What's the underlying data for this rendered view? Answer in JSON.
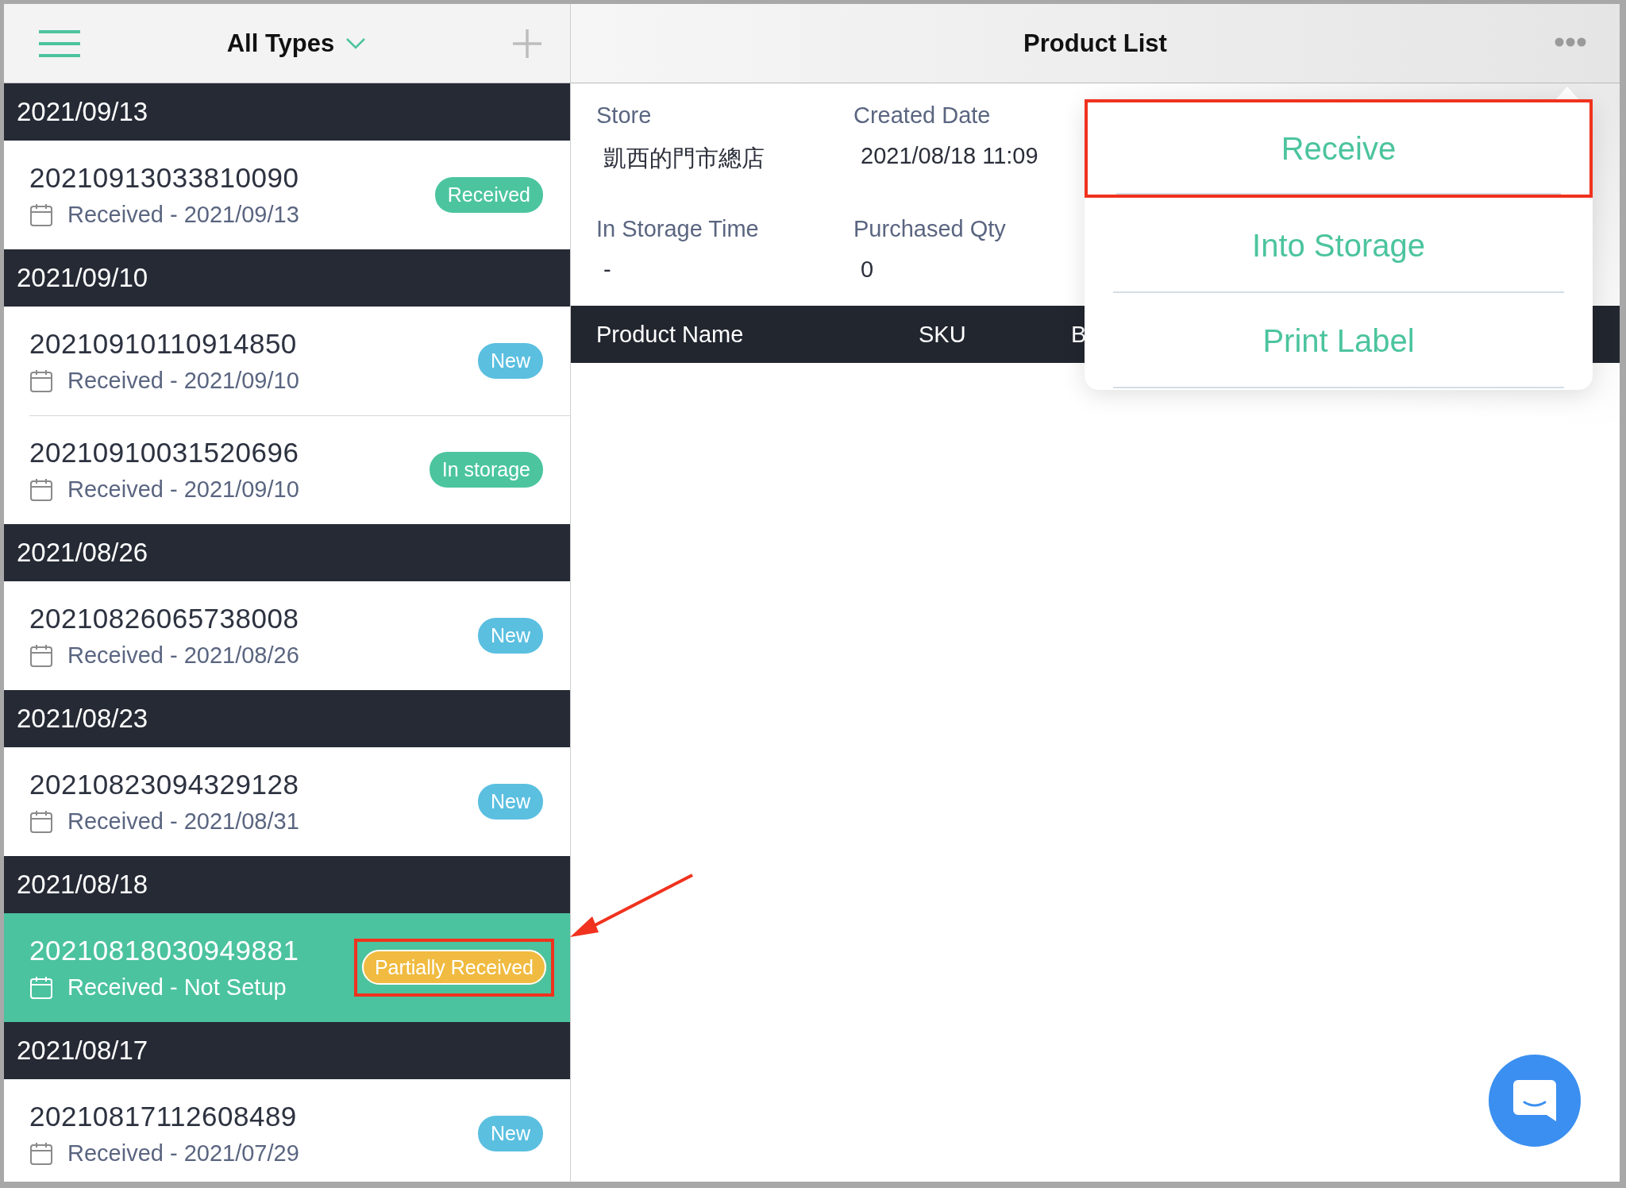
{
  "sidebar": {
    "title": "All Types",
    "groups": [
      {
        "date": "2021/09/13",
        "orders": [
          {
            "number": "20210913033810090",
            "subtitle": "Received - 2021/09/13",
            "status": "Received",
            "color": "#4cc59f",
            "selected": false,
            "highlighted": false
          }
        ]
      },
      {
        "date": "2021/09/10",
        "orders": [
          {
            "number": "20210910110914850",
            "subtitle": "Received - 2021/09/10",
            "status": "New",
            "color": "#5bbfe0",
            "selected": false,
            "highlighted": false
          },
          {
            "number": "20210910031520696",
            "subtitle": "Received - 2021/09/10",
            "status": "In storage",
            "color": "#4cc59f",
            "selected": false,
            "highlighted": false
          }
        ]
      },
      {
        "date": "2021/08/26",
        "orders": [
          {
            "number": "20210826065738008",
            "subtitle": "Received - 2021/08/26",
            "status": "New",
            "color": "#5bbfe0",
            "selected": false,
            "highlighted": false
          }
        ]
      },
      {
        "date": "2021/08/23",
        "orders": [
          {
            "number": "20210823094329128",
            "subtitle": "Received - 2021/08/31",
            "status": "New",
            "color": "#5bbfe0",
            "selected": false,
            "highlighted": false
          }
        ]
      },
      {
        "date": "2021/08/18",
        "orders": [
          {
            "number": "20210818030949881",
            "subtitle": "Received - Not Setup",
            "status": "Partially Received",
            "color": "#f0bb40",
            "selected": true,
            "highlighted": true
          }
        ]
      },
      {
        "date": "2021/08/17",
        "orders": [
          {
            "number": "20210817112608489",
            "subtitle": "Received - 2021/07/29",
            "status": "New",
            "color": "#5bbfe0",
            "selected": false,
            "highlighted": false
          }
        ]
      }
    ]
  },
  "detail": {
    "title": "Product List",
    "fields": [
      {
        "label": "Store",
        "value": "凱西的門市總店"
      },
      {
        "label": "Created Date",
        "value": "2021/08/18 11:09"
      },
      {
        "label": "In Storage Time",
        "value": "-"
      },
      {
        "label": "Purchased Qty",
        "value": "0"
      }
    ],
    "columns": [
      "Product Name",
      "SKU",
      "B"
    ]
  },
  "menu": {
    "items": [
      {
        "label": "Receive",
        "highlighted": true
      },
      {
        "label": "Into Storage",
        "highlighted": false
      },
      {
        "label": "Print Label",
        "highlighted": false
      }
    ]
  }
}
